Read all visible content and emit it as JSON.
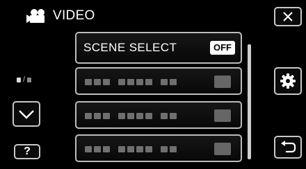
{
  "header": {
    "title": "VIDEO",
    "icon": "video-camera-icon"
  },
  "menu_items": [
    {
      "label": "SCENE SELECT",
      "value": "OFF"
    },
    {
      "label": "",
      "value": ""
    },
    {
      "label": "",
      "value": ""
    },
    {
      "label": "",
      "value": ""
    }
  ],
  "buttons": {
    "help_label": "?",
    "close_icon": "close-icon",
    "settings_icon": "gear-icon",
    "back_icon": "return-icon",
    "down_icon": "chevron-down-icon"
  },
  "colors": {
    "background": "#000000",
    "border": "#c8c8c8",
    "badge_bg": "#ffffff"
  }
}
